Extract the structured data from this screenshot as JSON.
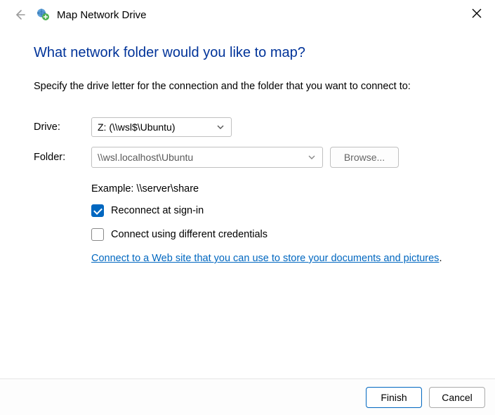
{
  "window": {
    "title": "Map Network Drive"
  },
  "heading": "What network folder would you like to map?",
  "instruction": "Specify the drive letter for the connection and the folder that you want to connect to:",
  "labels": {
    "drive": "Drive:",
    "folder": "Folder:"
  },
  "drive": {
    "selected": "Z: (\\\\wsl$\\Ubuntu)"
  },
  "folder": {
    "value": "\\\\wsl.localhost\\Ubuntu"
  },
  "browse_label": "Browse...",
  "example": "Example: \\\\server\\share",
  "checkbox_reconnect": {
    "label": "Reconnect at sign-in",
    "checked": true
  },
  "checkbox_credentials": {
    "label": "Connect using different credentials",
    "checked": false
  },
  "link_text": "Connect to a Web site that you can use to store your documents and pictures",
  "buttons": {
    "finish": "Finish",
    "cancel": "Cancel"
  }
}
